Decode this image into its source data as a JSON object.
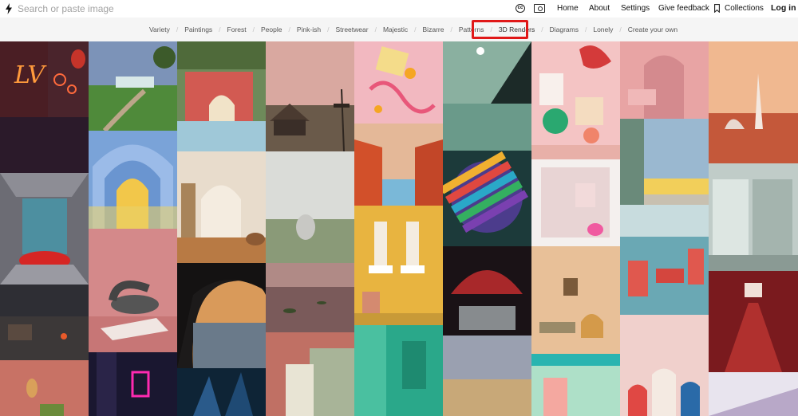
{
  "header": {
    "search_placeholder": "Search or paste image",
    "nav": {
      "home": "Home",
      "about": "About",
      "settings": "Settings",
      "feedback": "Give feedback",
      "collections": "Collections",
      "login": "Log in"
    },
    "icons": [
      "bolt-icon",
      "cc-icon",
      "camera-icon",
      "bookmark-icon"
    ]
  },
  "categories": {
    "items": [
      "Variety",
      "Paintings",
      "Forest",
      "People",
      "Pink-ish",
      "Streetwear",
      "Majestic",
      "Bizarre",
      "Patterns",
      "3D Renders",
      "Diagrams",
      "Lonely",
      "Create your own"
    ],
    "selected": "3D Renders",
    "highlight_color": "#e01818"
  }
}
